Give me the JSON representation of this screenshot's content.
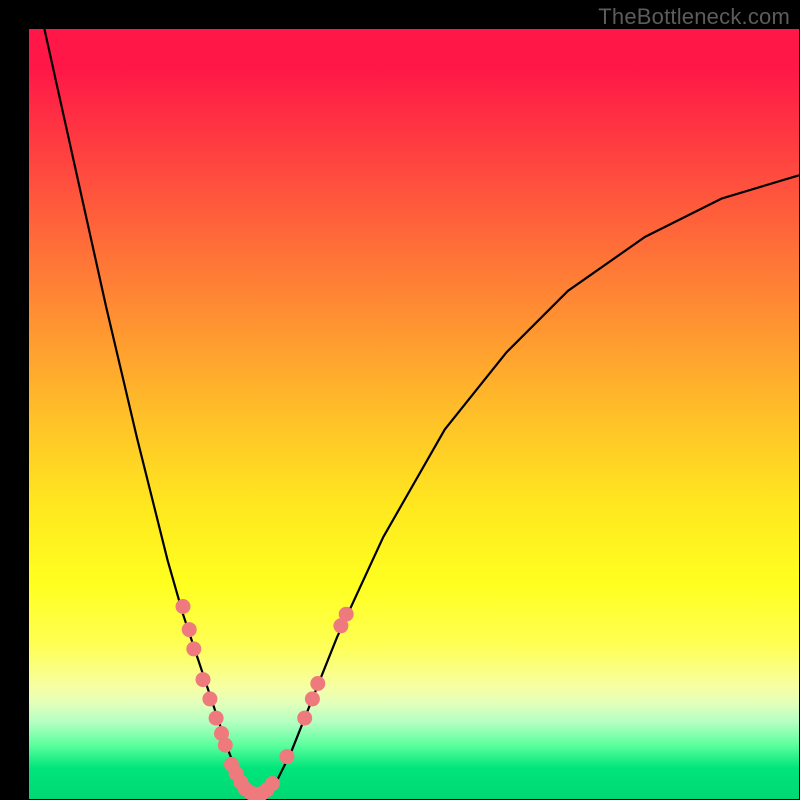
{
  "watermark": "TheBottleneck.com",
  "colors": {
    "frame": "#000000",
    "gradient_top": "#ff1747",
    "gradient_bottom": "#00d874",
    "curve": "#000000",
    "dots": "#ef7a7e"
  },
  "chart_data": {
    "type": "line",
    "title": "",
    "xlabel": "",
    "ylabel": "",
    "xlim": [
      0,
      100
    ],
    "ylim": [
      0,
      100
    ],
    "series": [
      {
        "name": "bottleneck-curve",
        "x": [
          2,
          6,
          10,
          14,
          18,
          20,
          22,
          24,
          25,
          26,
          27,
          28,
          29,
          30,
          32,
          34,
          36,
          40,
          46,
          54,
          62,
          70,
          80,
          90,
          100
        ],
        "y": [
          100,
          82,
          64,
          47,
          31,
          24,
          18,
          12,
          9,
          6,
          3.5,
          1.5,
          0.5,
          0.5,
          2,
          6,
          11,
          21,
          34,
          48,
          58,
          66,
          73,
          78,
          81
        ]
      }
    ],
    "points": [
      {
        "name": "left-cluster-1",
        "x": 20.0,
        "y": 25.0
      },
      {
        "name": "left-cluster-2",
        "x": 20.8,
        "y": 22.0
      },
      {
        "name": "left-cluster-3",
        "x": 21.4,
        "y": 19.5
      },
      {
        "name": "left-cluster-4",
        "x": 22.6,
        "y": 15.5
      },
      {
        "name": "left-cluster-5",
        "x": 23.5,
        "y": 13.0
      },
      {
        "name": "left-cluster-6",
        "x": 24.3,
        "y": 10.5
      },
      {
        "name": "left-cluster-7",
        "x": 25.0,
        "y": 8.5
      },
      {
        "name": "left-cluster-8",
        "x": 25.5,
        "y": 7.0
      },
      {
        "name": "bottom-1",
        "x": 26.3,
        "y": 4.5
      },
      {
        "name": "bottom-2",
        "x": 26.9,
        "y": 3.3
      },
      {
        "name": "bottom-3",
        "x": 27.5,
        "y": 2.2
      },
      {
        "name": "bottom-4",
        "x": 28.1,
        "y": 1.3
      },
      {
        "name": "bottom-5",
        "x": 28.8,
        "y": 0.8
      },
      {
        "name": "bottom-6",
        "x": 29.5,
        "y": 0.6
      },
      {
        "name": "bottom-7",
        "x": 30.2,
        "y": 0.7
      },
      {
        "name": "bottom-8",
        "x": 30.9,
        "y": 1.2
      },
      {
        "name": "bottom-9",
        "x": 31.6,
        "y": 2.0
      },
      {
        "name": "right-cluster-1",
        "x": 33.5,
        "y": 5.5
      },
      {
        "name": "right-cluster-2",
        "x": 35.8,
        "y": 10.5
      },
      {
        "name": "right-cluster-3",
        "x": 36.8,
        "y": 13.0
      },
      {
        "name": "right-cluster-4",
        "x": 37.5,
        "y": 15.0
      },
      {
        "name": "right-outlier-1",
        "x": 40.5,
        "y": 22.5
      },
      {
        "name": "right-outlier-2",
        "x": 41.2,
        "y": 24.0
      }
    ]
  }
}
